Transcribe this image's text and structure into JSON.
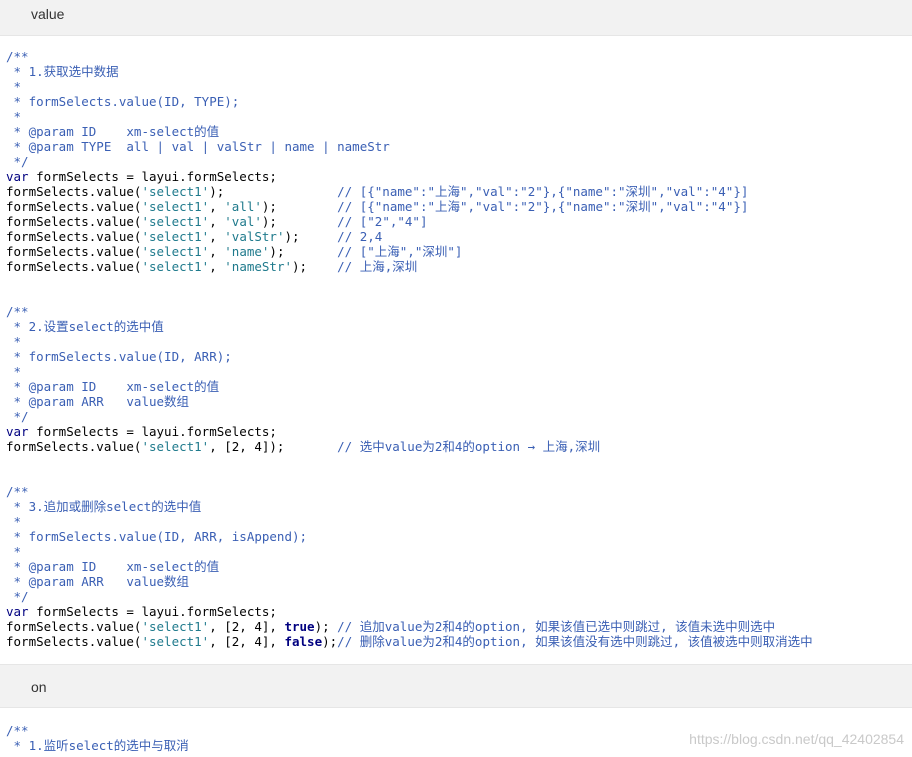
{
  "sections": [
    {
      "heading": "value"
    },
    {
      "heading": "on"
    }
  ],
  "code": {
    "block1": [
      "/**",
      " * 1.获取选中数据",
      " *",
      " * formSelects.value(ID, TYPE);",
      " *",
      " * @param ID    xm-select的值",
      " * @param TYPE  all | val | valStr | name | nameStr",
      " */",
      "var formSelects = layui.formSelects;",
      "formSelects.value('select1');               // [{\"name\":\"上海\",\"val\":\"2\"},{\"name\":\"深圳\",\"val\":\"4\"}]",
      "formSelects.value('select1', 'all');        // [{\"name\":\"上海\",\"val\":\"2\"},{\"name\":\"深圳\",\"val\":\"4\"}]",
      "formSelects.value('select1', 'val');        // [\"2\",\"4\"]",
      "formSelects.value('select1', 'valStr');     // 2,4",
      "formSelects.value('select1', 'name');       // [\"上海\",\"深圳\"]",
      "formSelects.value('select1', 'nameStr');    // 上海,深圳",
      "",
      "",
      "/**",
      " * 2.设置select的选中值",
      " *",
      " * formSelects.value(ID, ARR);",
      " *",
      " * @param ID    xm-select的值",
      " * @param ARR   value数组",
      " */",
      "var formSelects = layui.formSelects;",
      "formSelects.value('select1', [2, 4]);       // 选中value为2和4的option → 上海,深圳",
      "",
      "",
      "/**",
      " * 3.追加或删除select的选中值",
      " *",
      " * formSelects.value(ID, ARR, isAppend);",
      " *",
      " * @param ID    xm-select的值",
      " * @param ARR   value数组",
      " */",
      "var formSelects = layui.formSelects;",
      "formSelects.value('select1', [2, 4], true); // 追加value为2和4的option, 如果该值已选中则跳过, 该值未选中则选中",
      "formSelects.value('select1', [2, 4], false);// 删除value为2和4的option, 如果该值没有选中则跳过, 该值被选中则取消选中"
    ],
    "block2": [
      "/**",
      " * 1.监听select的选中与取消"
    ]
  },
  "watermark": "https://blog.csdn.net/qq_42402854"
}
